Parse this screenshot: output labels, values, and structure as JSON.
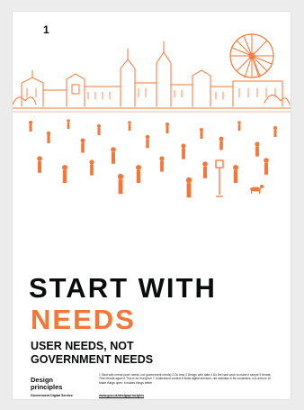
{
  "poster": {
    "number": "1",
    "title_line1": "START WITH",
    "title_line2": "NEEDS",
    "subtitle": "USER NEEDS, NOT GOVERNMENT NEEDS",
    "logo_title": "Design principles",
    "logo_org": "Government Digital Service",
    "principles_text": "1 Start with needs (user needs, not government needs) 2 Do less 3 Design with data 4 Do the hard work to make it simple 5 Iterate. Then iterate again 6 This is for everyone 7 Understand context 8 Build digital services, not websites 9 Be consistent, not uniform 10 Make things open: it makes things better",
    "url": "www.gov.uk/designprinciples",
    "illustration_icon": "horse-guards-parade-illustration",
    "colors": {
      "accent": "#f47738",
      "text": "#0b0c0c",
      "background": "#ececec",
      "poster": "#ffffff"
    }
  }
}
